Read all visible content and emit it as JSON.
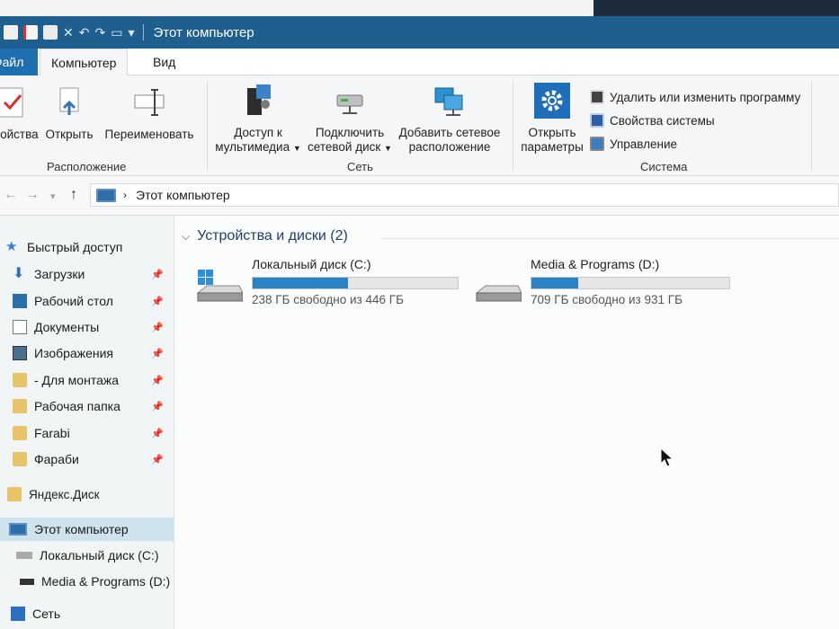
{
  "window": {
    "title": "Этот компьютер"
  },
  "tabs": {
    "file": "Файл",
    "computer": "Компьютер",
    "view": "Вид"
  },
  "ribbon": {
    "location": {
      "label": "Расположение",
      "properties": "Свойства",
      "open": "Открыть",
      "rename": "Переименовать"
    },
    "network": {
      "label": "Сеть",
      "media_access_line1": "Доступ к",
      "media_access_line2": "мультимедиа",
      "map_drive_line1": "Подключить",
      "map_drive_line2": "сетевой диск",
      "add_location_line1": "Добавить сетевое",
      "add_location_line2": "расположение"
    },
    "system": {
      "label": "Система",
      "open_settings_line1": "Открыть",
      "open_settings_line2": "параметры",
      "uninstall": "Удалить или изменить программу",
      "system_properties": "Свойства системы",
      "manage": "Управление"
    }
  },
  "address": {
    "path": "Этот компьютер"
  },
  "sidebar": {
    "quick_access": "Быстрый доступ",
    "items": [
      {
        "label": "Загрузки"
      },
      {
        "label": "Рабочий стол"
      },
      {
        "label": "Документы"
      },
      {
        "label": "Изображения"
      },
      {
        "label": "- Для монтажа"
      },
      {
        "label": "Рабочая папка"
      },
      {
        "label": "Farabi"
      },
      {
        "label": "Фараби"
      }
    ],
    "yandex": "Яндекс.Диск",
    "this_pc": "Этот компьютер",
    "drive_c": "Локальный диск (C:)",
    "drive_d": "Media & Programs (D:)",
    "network": "Сеть"
  },
  "main": {
    "section_title": "Устройства и диски (2)",
    "drives": [
      {
        "name": "Локальный диск (C:)",
        "free_text": "238 ГБ свободно из 446 ГБ",
        "used_fraction": 0.466
      },
      {
        "name": "Media & Programs (D:)",
        "free_text": "709 ГБ свободно из 931 ГБ",
        "used_fraction": 0.238
      }
    ]
  },
  "colors": {
    "titlebar": "#1e5f8f",
    "accent": "#2a82c9",
    "selection": "#cfe3ef"
  }
}
